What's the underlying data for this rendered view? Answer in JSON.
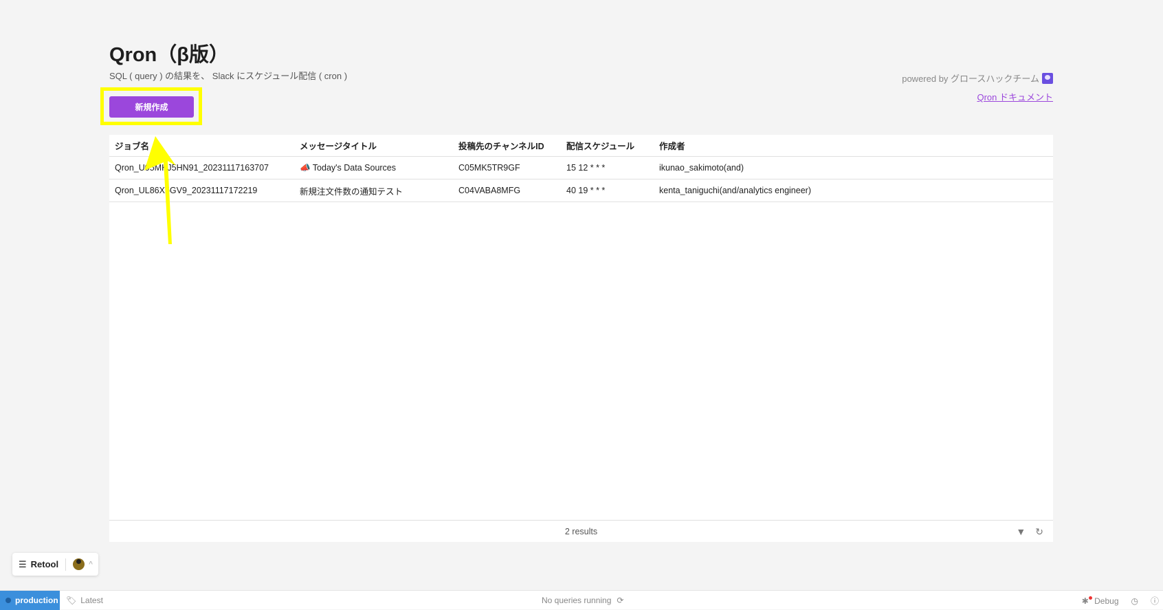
{
  "header": {
    "title": "Qron（β版）",
    "subtitle": "SQL ( query ) の結果を、 Slack にスケジュール配信 ( cron )",
    "new_button": "新規作成",
    "powered_by": "powered by グロースハックチーム",
    "doc_link": "Qron ドキュメント"
  },
  "table": {
    "columns": [
      "ジョブ名",
      "メッセージタイトル",
      "投稿先のチャンネルID",
      "配信スケジュール",
      "作成者"
    ],
    "rows": [
      [
        "Qron_U05MKJ5HN91_20231117163707",
        "📣 Today's Data Sources",
        "C05MK5TR9GF",
        "15 12 * * *",
        "ikunao_sakimoto(and)"
      ],
      [
        "Qron_UL86X5GV9_20231117172219",
        "新規注文件数の通知テスト",
        "C04VABA8MFG",
        "40 19 * * *",
        "kenta_taniguchi(and/analytics engineer)"
      ]
    ],
    "footer": "2 results"
  },
  "retool": {
    "label": "Retool"
  },
  "statusbar": {
    "env": "production",
    "version": "Latest",
    "queries": "No queries running",
    "debug": "Debug"
  },
  "colors": {
    "accent": "#9b47dc",
    "highlight": "#ffff00",
    "env": "#3b8fdc"
  }
}
